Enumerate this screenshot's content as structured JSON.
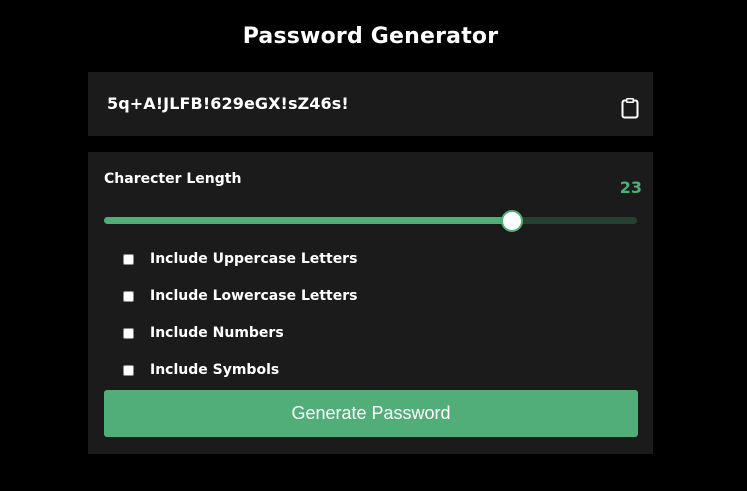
{
  "header": {
    "title": "Password Generator"
  },
  "output": {
    "password": "5q+A!JLFB!629eGX!sZ46s!",
    "copy_icon": "clipboard-icon"
  },
  "length": {
    "label": "Charecter Length",
    "value": "23",
    "slider_fraction": 0.766
  },
  "options": [
    {
      "label": "Include Uppercase Letters",
      "checked": false
    },
    {
      "label": "Include Lowercase Letters",
      "checked": false
    },
    {
      "label": "Include Numbers",
      "checked": false
    },
    {
      "label": "Include Symbols",
      "checked": false
    }
  ],
  "actions": {
    "generate_label": "Generate Password"
  },
  "colors": {
    "accent": "#4eaf77",
    "panel": "#1b1b1b",
    "background": "#000000",
    "track": "#25412f"
  }
}
